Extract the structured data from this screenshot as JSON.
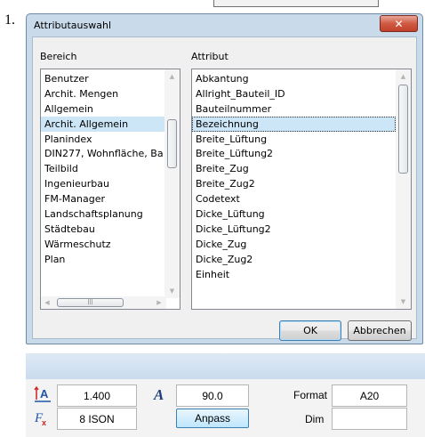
{
  "list_number": "1.",
  "dialog": {
    "title": "Attributauswahl",
    "close_glyph": "✕",
    "left_label": "Bereich",
    "right_label": "Attribut",
    "bereich_items": [
      "Benutzer",
      "Archit. Mengen",
      "Allgemein",
      "Archit. Allgemein",
      "Planindex",
      "DIN277, Wohnfläche, Ba",
      "Teilbild",
      "Ingenieurbau",
      "FM-Manager",
      "Landschaftsplanung",
      "Städtebau",
      "Wärmeschutz",
      "Plan"
    ],
    "bereich_selected": "Archit. Allgemein",
    "attribut_items": [
      "Abkantung",
      "Allright_Bauteil_ID",
      "Bauteilnummer",
      "Bezeichnung",
      "Breite_Lüftung",
      "Breite_Lüftung2",
      "Breite_Zug",
      "Breite_Zug2",
      "Codetext",
      "Dicke_Lüftung",
      "Dicke_Lüftung2",
      "Dicke_Zug",
      "Dicke_Zug2",
      "Einheit"
    ],
    "attribut_selected": "Bezeichnung",
    "ok_label": "OK",
    "cancel_label": "Abbrechen"
  },
  "text_panel": {
    "height_value": "1.400",
    "angle_value": "90.0",
    "format_label": "Format",
    "format_value": "A20",
    "font_value": "8 ISON",
    "anpass_label": "Anpass",
    "dim_label": "Dim",
    "dim_value": ""
  },
  "icons": {
    "close": "close-icon",
    "text_height": "text-height-icon",
    "angle": "text-angle-icon",
    "font": "font-icon"
  },
  "colors": {
    "title_bg": "#c9daea",
    "selection": "#cde6f7",
    "close_red": "#c2412a",
    "icon_blue": "#1f55a8",
    "icon_red": "#cc2222"
  }
}
